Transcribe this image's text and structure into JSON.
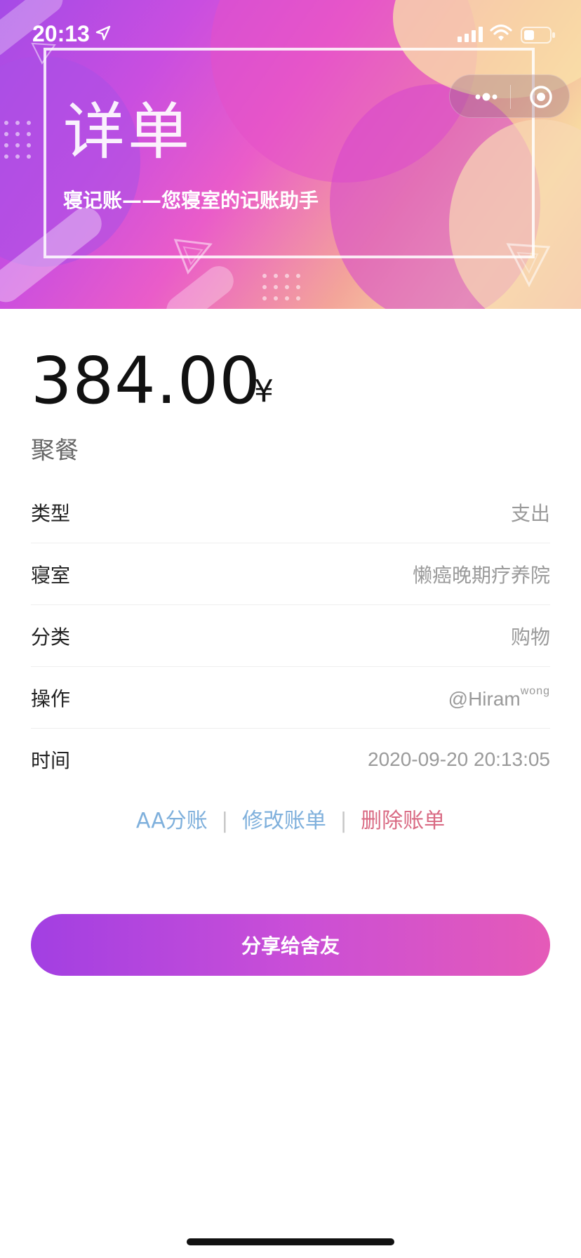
{
  "status_bar": {
    "time": "20:13",
    "icons": [
      "location-arrow-icon",
      "signal-icon",
      "wifi-icon",
      "battery-icon"
    ]
  },
  "header": {
    "title": "详单",
    "subtitle": "寝记账——您寝室的记账助手"
  },
  "capsule": {
    "icons": [
      "more-dots-icon",
      "close-target-icon"
    ]
  },
  "bill": {
    "amount": "384.00",
    "currency": "¥",
    "name": "聚餐"
  },
  "details": [
    {
      "label": "类型",
      "value": "支出"
    },
    {
      "label": "寝室",
      "value": "懒癌晚期疗养院"
    },
    {
      "label": "分类",
      "value": "购物"
    },
    {
      "label": "操作",
      "value": "@Hiram",
      "value_sup": "wong"
    },
    {
      "label": "时间",
      "value": "2020-09-20 20:13:05"
    }
  ],
  "actions": {
    "split": "AA分账",
    "edit": "修改账单",
    "delete": "删除账单",
    "separator": "|"
  },
  "share_button": "分享给舍友",
  "colors": {
    "action_link": "#7fb0dc",
    "danger_link": "#d96a83",
    "button_gradient_start": "#a23fe2",
    "button_gradient_end": "#e55ab8"
  }
}
